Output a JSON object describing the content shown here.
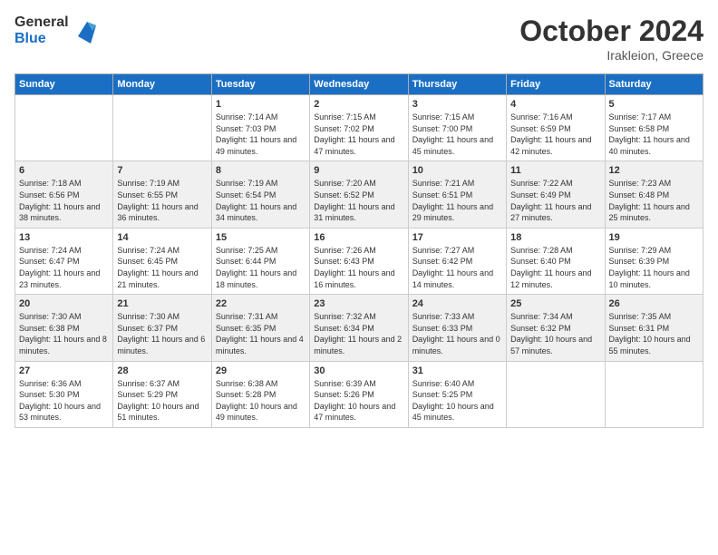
{
  "header": {
    "logo_general": "General",
    "logo_blue": "Blue",
    "month_year": "October 2024",
    "location": "Irakleion, Greece"
  },
  "days_of_week": [
    "Sunday",
    "Monday",
    "Tuesday",
    "Wednesday",
    "Thursday",
    "Friday",
    "Saturday"
  ],
  "weeks": [
    [
      {
        "day": "",
        "content": ""
      },
      {
        "day": "",
        "content": ""
      },
      {
        "day": "1",
        "content": "Sunrise: 7:14 AM\nSunset: 7:03 PM\nDaylight: 11 hours and 49 minutes."
      },
      {
        "day": "2",
        "content": "Sunrise: 7:15 AM\nSunset: 7:02 PM\nDaylight: 11 hours and 47 minutes."
      },
      {
        "day": "3",
        "content": "Sunrise: 7:15 AM\nSunset: 7:00 PM\nDaylight: 11 hours and 45 minutes."
      },
      {
        "day": "4",
        "content": "Sunrise: 7:16 AM\nSunset: 6:59 PM\nDaylight: 11 hours and 42 minutes."
      },
      {
        "day": "5",
        "content": "Sunrise: 7:17 AM\nSunset: 6:58 PM\nDaylight: 11 hours and 40 minutes."
      }
    ],
    [
      {
        "day": "6",
        "content": "Sunrise: 7:18 AM\nSunset: 6:56 PM\nDaylight: 11 hours and 38 minutes."
      },
      {
        "day": "7",
        "content": "Sunrise: 7:19 AM\nSunset: 6:55 PM\nDaylight: 11 hours and 36 minutes."
      },
      {
        "day": "8",
        "content": "Sunrise: 7:19 AM\nSunset: 6:54 PM\nDaylight: 11 hours and 34 minutes."
      },
      {
        "day": "9",
        "content": "Sunrise: 7:20 AM\nSunset: 6:52 PM\nDaylight: 11 hours and 31 minutes."
      },
      {
        "day": "10",
        "content": "Sunrise: 7:21 AM\nSunset: 6:51 PM\nDaylight: 11 hours and 29 minutes."
      },
      {
        "day": "11",
        "content": "Sunrise: 7:22 AM\nSunset: 6:49 PM\nDaylight: 11 hours and 27 minutes."
      },
      {
        "day": "12",
        "content": "Sunrise: 7:23 AM\nSunset: 6:48 PM\nDaylight: 11 hours and 25 minutes."
      }
    ],
    [
      {
        "day": "13",
        "content": "Sunrise: 7:24 AM\nSunset: 6:47 PM\nDaylight: 11 hours and 23 minutes."
      },
      {
        "day": "14",
        "content": "Sunrise: 7:24 AM\nSunset: 6:45 PM\nDaylight: 11 hours and 21 minutes."
      },
      {
        "day": "15",
        "content": "Sunrise: 7:25 AM\nSunset: 6:44 PM\nDaylight: 11 hours and 18 minutes."
      },
      {
        "day": "16",
        "content": "Sunrise: 7:26 AM\nSunset: 6:43 PM\nDaylight: 11 hours and 16 minutes."
      },
      {
        "day": "17",
        "content": "Sunrise: 7:27 AM\nSunset: 6:42 PM\nDaylight: 11 hours and 14 minutes."
      },
      {
        "day": "18",
        "content": "Sunrise: 7:28 AM\nSunset: 6:40 PM\nDaylight: 11 hours and 12 minutes."
      },
      {
        "day": "19",
        "content": "Sunrise: 7:29 AM\nSunset: 6:39 PM\nDaylight: 11 hours and 10 minutes."
      }
    ],
    [
      {
        "day": "20",
        "content": "Sunrise: 7:30 AM\nSunset: 6:38 PM\nDaylight: 11 hours and 8 minutes."
      },
      {
        "day": "21",
        "content": "Sunrise: 7:30 AM\nSunset: 6:37 PM\nDaylight: 11 hours and 6 minutes."
      },
      {
        "day": "22",
        "content": "Sunrise: 7:31 AM\nSunset: 6:35 PM\nDaylight: 11 hours and 4 minutes."
      },
      {
        "day": "23",
        "content": "Sunrise: 7:32 AM\nSunset: 6:34 PM\nDaylight: 11 hours and 2 minutes."
      },
      {
        "day": "24",
        "content": "Sunrise: 7:33 AM\nSunset: 6:33 PM\nDaylight: 11 hours and 0 minutes."
      },
      {
        "day": "25",
        "content": "Sunrise: 7:34 AM\nSunset: 6:32 PM\nDaylight: 10 hours and 57 minutes."
      },
      {
        "day": "26",
        "content": "Sunrise: 7:35 AM\nSunset: 6:31 PM\nDaylight: 10 hours and 55 minutes."
      }
    ],
    [
      {
        "day": "27",
        "content": "Sunrise: 6:36 AM\nSunset: 5:30 PM\nDaylight: 10 hours and 53 minutes."
      },
      {
        "day": "28",
        "content": "Sunrise: 6:37 AM\nSunset: 5:29 PM\nDaylight: 10 hours and 51 minutes."
      },
      {
        "day": "29",
        "content": "Sunrise: 6:38 AM\nSunset: 5:28 PM\nDaylight: 10 hours and 49 minutes."
      },
      {
        "day": "30",
        "content": "Sunrise: 6:39 AM\nSunset: 5:26 PM\nDaylight: 10 hours and 47 minutes."
      },
      {
        "day": "31",
        "content": "Sunrise: 6:40 AM\nSunset: 5:25 PM\nDaylight: 10 hours and 45 minutes."
      },
      {
        "day": "",
        "content": ""
      },
      {
        "day": "",
        "content": ""
      }
    ]
  ]
}
